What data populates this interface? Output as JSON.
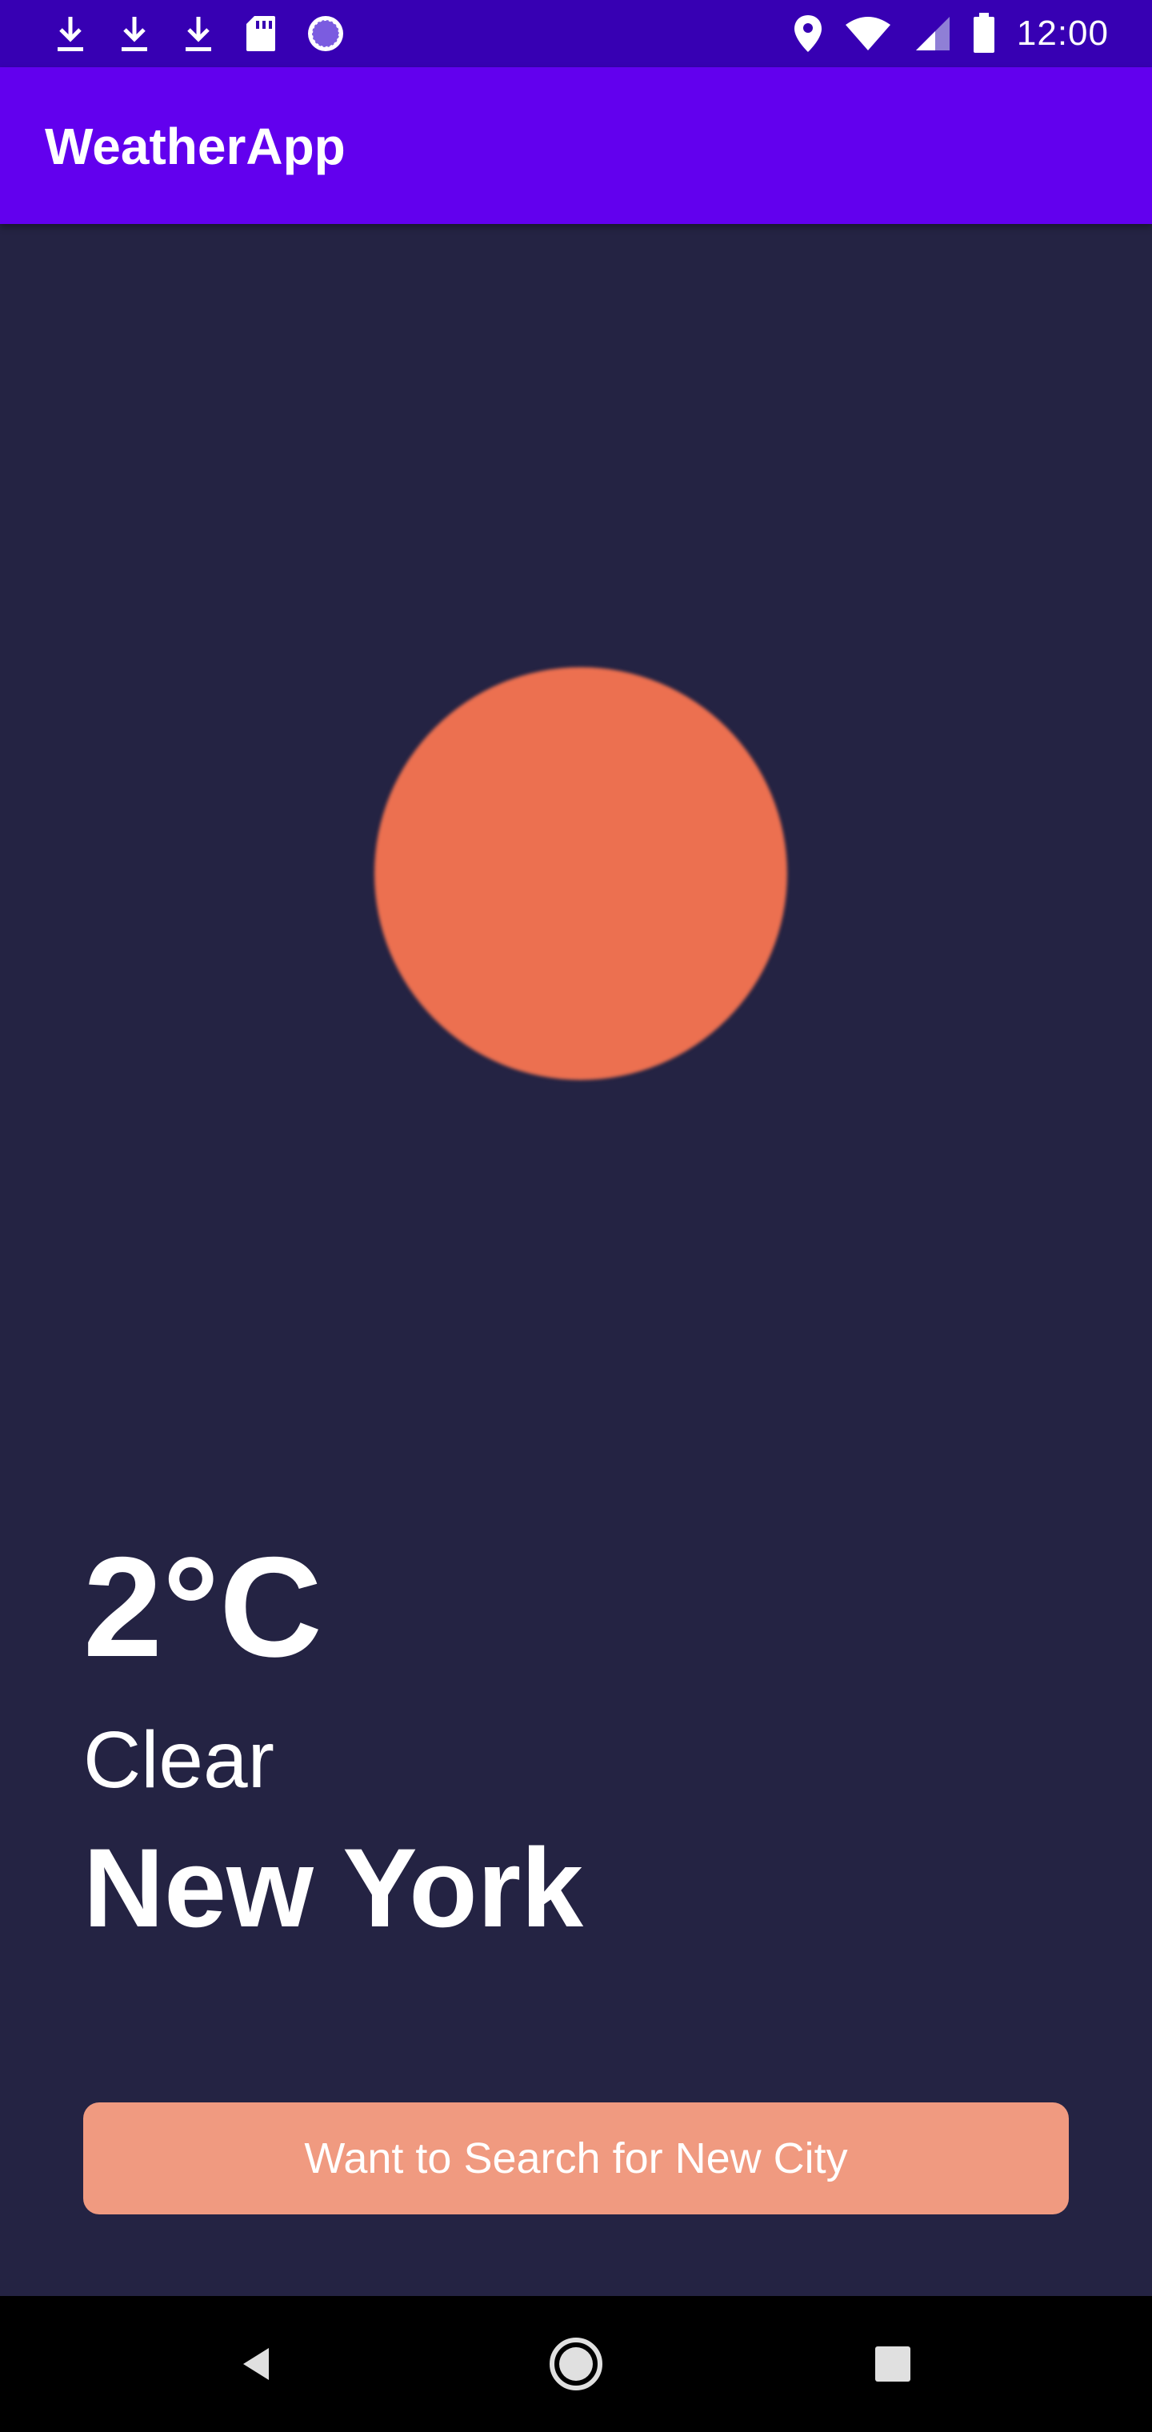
{
  "status_bar": {
    "time": "12:00",
    "left_icons": [
      "download-icon",
      "download-icon",
      "download-icon",
      "sd-card-icon",
      "sync-circle-icon"
    ],
    "right_icons": [
      "location-icon",
      "wifi-icon",
      "signal-icon",
      "battery-icon"
    ]
  },
  "app_bar": {
    "title": "WeatherApp"
  },
  "weather": {
    "icon": "sun-icon",
    "temperature": "2°C",
    "condition": "Clear",
    "city": "New York"
  },
  "actions": {
    "search_button_label": "Want to Search for New City"
  },
  "nav_bar": {
    "buttons": [
      "back-icon",
      "home-icon",
      "recents-icon"
    ]
  },
  "colors": {
    "status_bar": "#3700B3",
    "app_bar": "#6200EE",
    "background": "#242343",
    "sun": "#EC7050",
    "button": "#F09A80"
  }
}
